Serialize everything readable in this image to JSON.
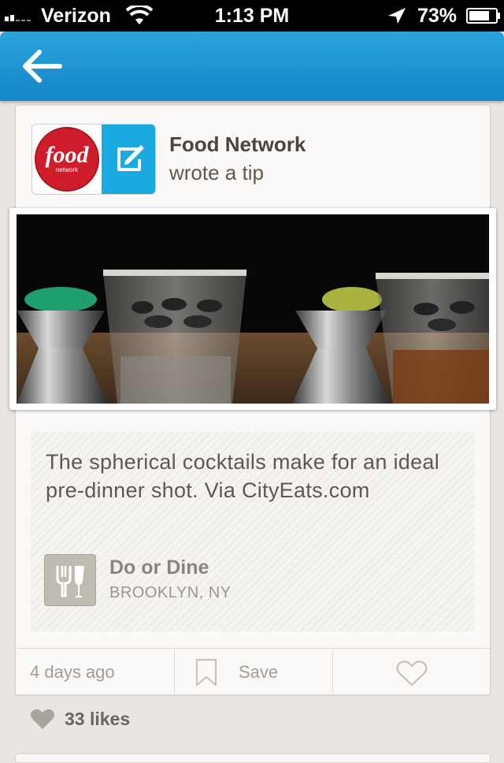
{
  "status_bar": {
    "carrier": "Verizon",
    "time": "1:13 PM",
    "battery": "73%"
  },
  "nav": {
    "back_icon": "arrow-left-icon"
  },
  "tip": {
    "author_name": "Food Network",
    "author_action": "wrote a tip",
    "author_logo_text": "food",
    "author_logo_subtext": "network",
    "text": "The spherical cocktails make for an ideal pre-dinner shot. Via CityEats.com",
    "venue": {
      "name": "Do or Dine",
      "location": "BROOKLYN, NY",
      "icon": "fork-glass-icon"
    }
  },
  "actions": {
    "date": "4 days ago",
    "save_label": "Save"
  },
  "likes": {
    "label": "33 likes"
  },
  "colors": {
    "nav_blue": "#1a95d2",
    "tip_badge": "#1aa9e0",
    "food_red": "#d01d2c"
  }
}
